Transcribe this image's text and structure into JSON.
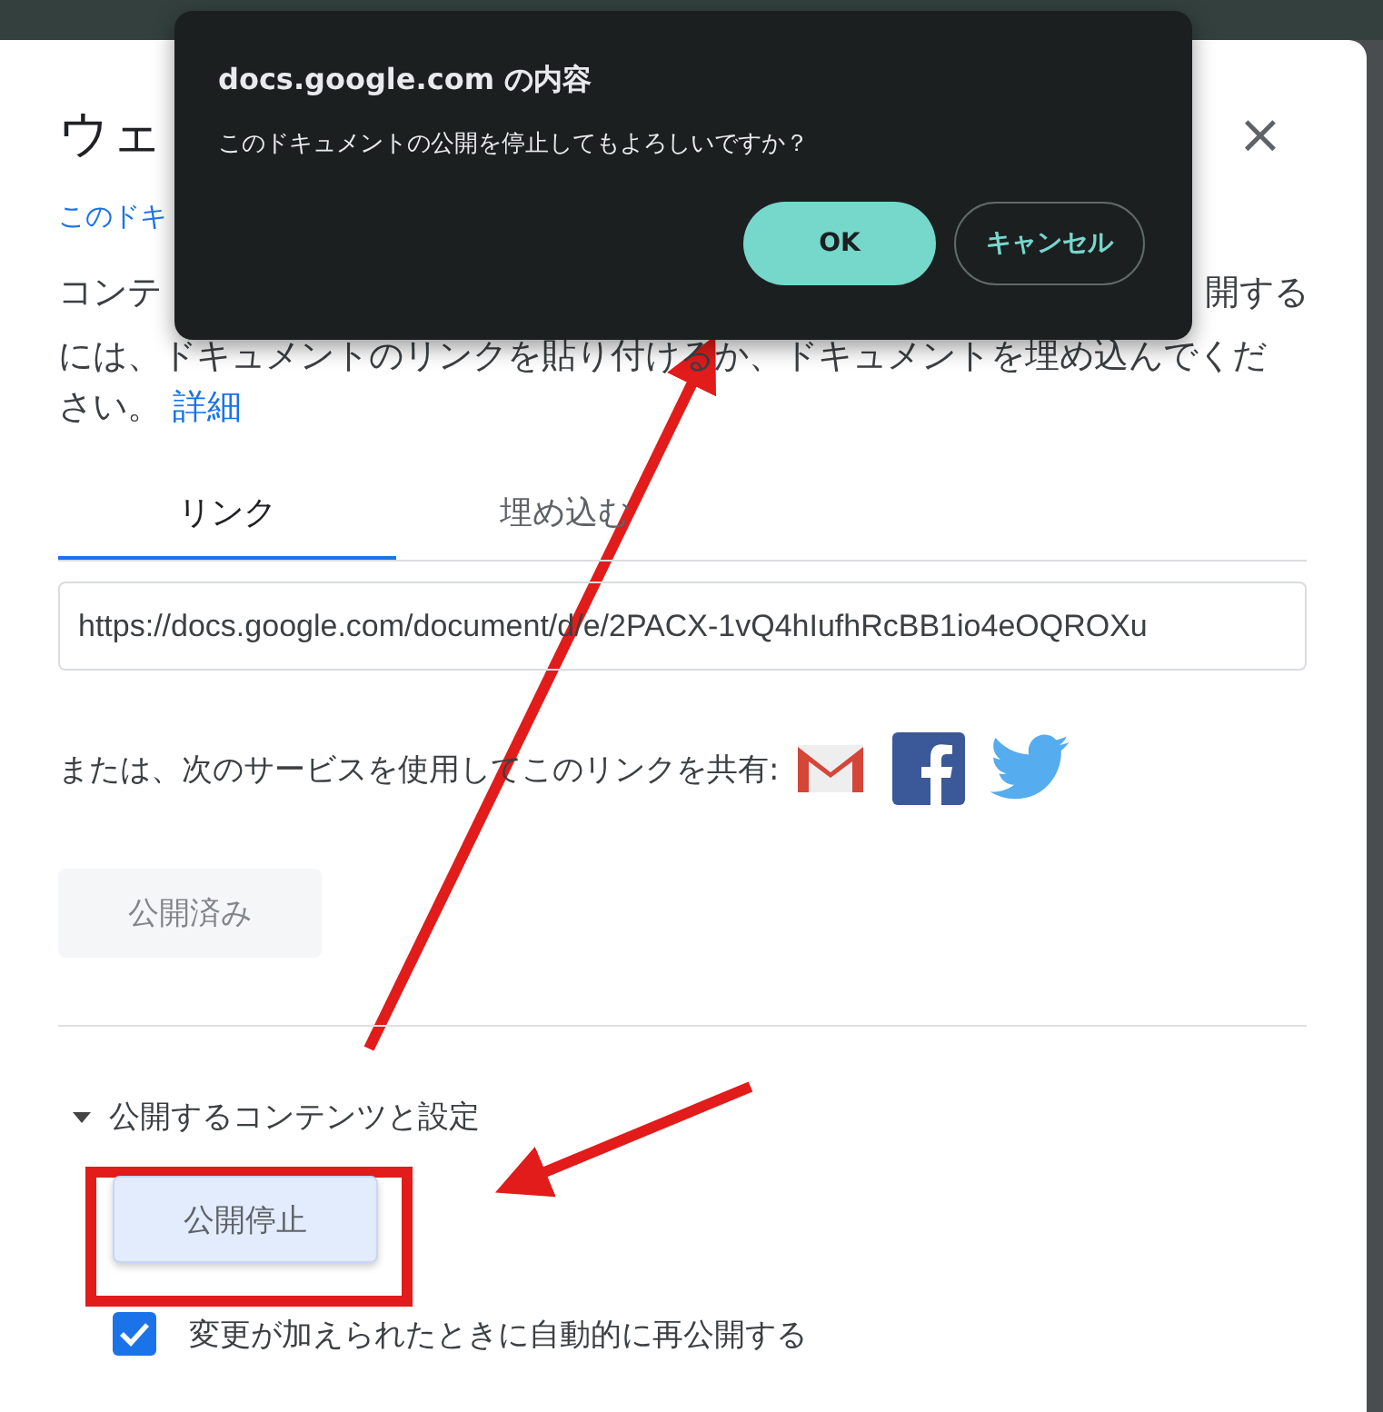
{
  "dialog": {
    "title": "ウェ",
    "close": "×",
    "link": "このドキ",
    "description_start": "コンテ",
    "description_end": "開する",
    "description": "には、ドキュメントのリンクを貼り付けるか、ドキュメントを埋め込んでください。",
    "learn_more": "詳細",
    "tabs": [
      {
        "label": "リンク",
        "selected": true
      },
      {
        "label": "埋め込む",
        "selected": false
      }
    ],
    "url": "https://docs.google.com/document/d/e/2PACX-1vQ4hIufhRcBB1io4eOQROXu",
    "share_label": "または、次のサービスを使用してこのリンクを共有:",
    "published_button": "公開済み",
    "section": {
      "label": "公開するコンテンツと設定",
      "expanded": true
    },
    "stop_button": "公開停止",
    "auto_republish": {
      "label": "変更が加えられたときに自動的に再公開する",
      "checked": true
    }
  },
  "alert": {
    "title": "docs.google.com の内容",
    "message": "このドキュメントの公開を停止してもよろしいですか？",
    "buttons": [
      {
        "label": "OK",
        "kind": "primary"
      },
      {
        "label": "キャンセル",
        "kind": "secondary"
      }
    ]
  }
}
